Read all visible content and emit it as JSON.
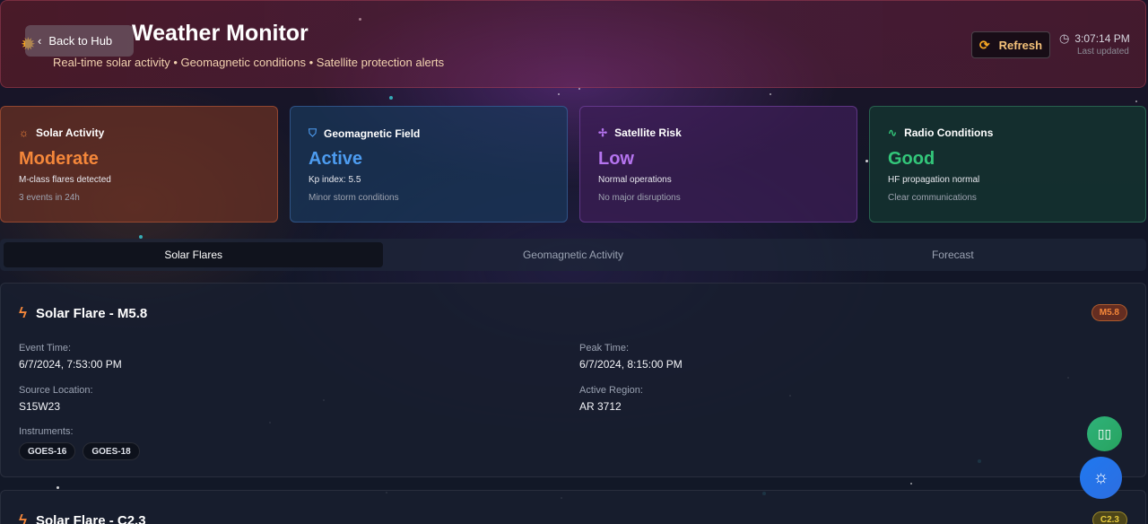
{
  "header": {
    "back_label": "Back to Hub",
    "title": "Weather Monitor",
    "subtitle": "Real-time solar activity • Geomagnetic conditions • Satellite protection alerts",
    "refresh_label": "Refresh",
    "time": "3:07:14 PM",
    "last_updated": "Last updated"
  },
  "status_cards": [
    {
      "label": "Solar Activity",
      "value": "Moderate",
      "desc": "M-class flares detected",
      "sub": "3 events in 24h",
      "icon": "sun-icon",
      "color": "#f5873a"
    },
    {
      "label": "Geomagnetic Field",
      "value": "Active",
      "desc": "Kp index: 5.5",
      "sub": "Minor storm conditions",
      "icon": "shield-icon",
      "color": "#4d9cf0"
    },
    {
      "label": "Satellite Risk",
      "value": "Low",
      "desc": "Normal operations",
      "sub": "No major disruptions",
      "icon": "satellite-icon",
      "color": "#b574ef"
    },
    {
      "label": "Radio Conditions",
      "value": "Good",
      "desc": "HF propagation normal",
      "sub": "Clear communications",
      "icon": "activity-icon",
      "color": "#33c77a"
    }
  ],
  "tabs": [
    "Solar Flares",
    "Geomagnetic Activity",
    "Forecast"
  ],
  "active_tab": "Solar Flares",
  "events": [
    {
      "title": "Solar Flare - M5.8",
      "badge": "M5.8",
      "event_time_label": "Event Time:",
      "event_time": "6/7/2024, 7:53:00 PM",
      "peak_time_label": "Peak Time:",
      "peak_time": "6/7/2024, 8:15:00 PM",
      "source_label": "Source Location:",
      "source": "S15W23",
      "region_label": "Active Region:",
      "region": "AR 3712",
      "instruments_label": "Instruments:",
      "instruments": [
        "GOES-16",
        "GOES-18"
      ]
    },
    {
      "title": "Solar Flare - C2.3",
      "badge": "C2.3"
    }
  ],
  "icons": {
    "back": "chevron-left-icon",
    "refresh": "refresh-icon",
    "clock": "clock-icon",
    "flare": "zap-icon",
    "book": "book-open-icon",
    "theme": "sun-icon"
  }
}
